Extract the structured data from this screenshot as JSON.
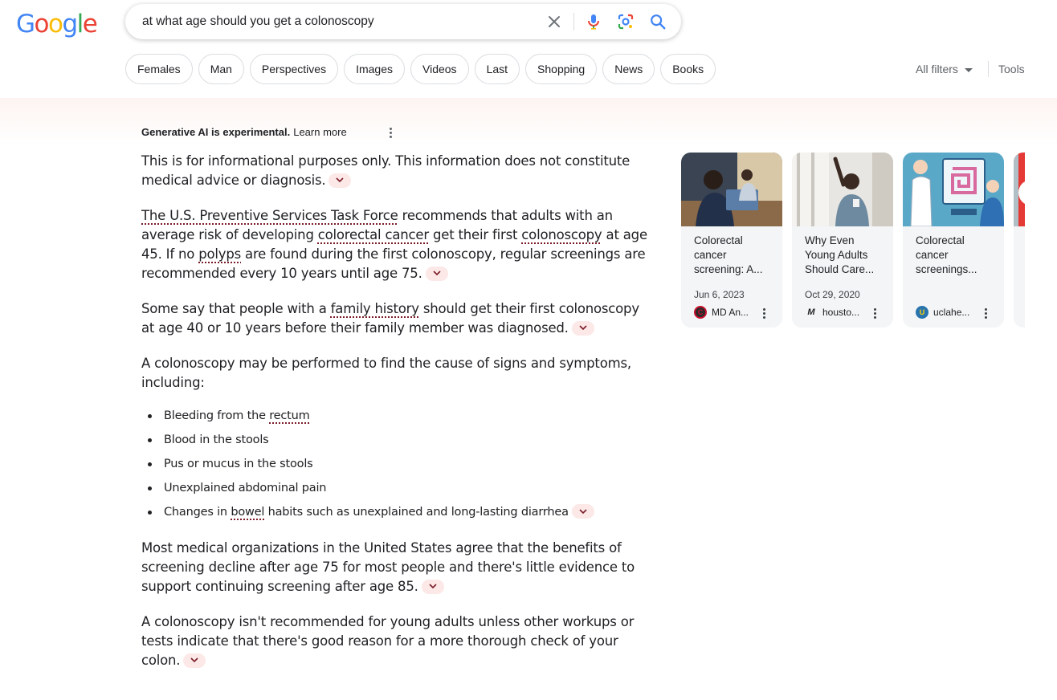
{
  "header": {
    "logo": "Google",
    "search_query": "at what age should you get a colonoscopy"
  },
  "chips": [
    "Females",
    "Man",
    "Perspectives",
    "Images",
    "Videos",
    "Last",
    "Shopping",
    "News",
    "Books"
  ],
  "toolbar": {
    "all_filters": "All filters",
    "tools": "Tools"
  },
  "ai": {
    "experimental": "Generative AI is experimental.",
    "learn_more": "Learn more",
    "p1": "This is for informational purposes only. This information does not constitute medical advice or diagnosis.",
    "p2": {
      "link1": "The U.S. Preventive Services Task Force",
      "t1": " recommends that adults with an average risk of developing ",
      "link2": "colorectal cancer",
      "t2": " get their first ",
      "link3": "colonoscopy",
      "t3": " at age 45. If no ",
      "link4": "polyps",
      "t4": " are found during the first colonoscopy, regular screenings are recommended every 10 years until age 75."
    },
    "p3": {
      "t1": "Some say that people with a ",
      "link1": "family history",
      "t2": " should get their first colonoscopy at age 40 or 10 years before their family member was diagnosed."
    },
    "p4": "A colonoscopy may be performed to find the cause of signs and symptoms, including:",
    "bullets": {
      "b1_t": "Bleeding from the ",
      "b1_link": "rectum",
      "b2": "Blood in the stools",
      "b3": "Pus or mucus in the stools",
      "b4": "Unexplained abdominal pain",
      "b5_t1": "Changes in ",
      "b5_link": "bowel",
      "b5_t2": " habits such as unexplained and long-lasting diarrhea"
    },
    "p5": "Most medical organizations in the United States agree that the benefits of screening decline after age 75 for most people and there's little evidence to support continuing screening after age 85.",
    "p6": "A colonoscopy isn't recommended for young adults unless other workups or tests indicate that there's good reason for a more thorough check of your colon."
  },
  "cards": [
    {
      "title": "Colorectal cancer screening: A...",
      "date": "Jun 6, 2023",
      "source": "MD An..."
    },
    {
      "title": "Why Even Young Adults Should Care...",
      "date": "Oct 29, 2020",
      "source": "housto..."
    },
    {
      "title": "Colorectal cancer screenings...",
      "date": "",
      "source": "uclahe..."
    }
  ],
  "colors": {
    "google_blue": "#4285F4",
    "google_red": "#EA4335",
    "google_yellow": "#FBBC05",
    "google_green": "#34A853",
    "dotted_underline": "#7a1b28",
    "expand_chip": "#fce8e6"
  },
  "icons": [
    "close-icon",
    "microphone-icon",
    "lens-icon",
    "search-icon",
    "more-vert-icon",
    "chevron-down-icon"
  ]
}
